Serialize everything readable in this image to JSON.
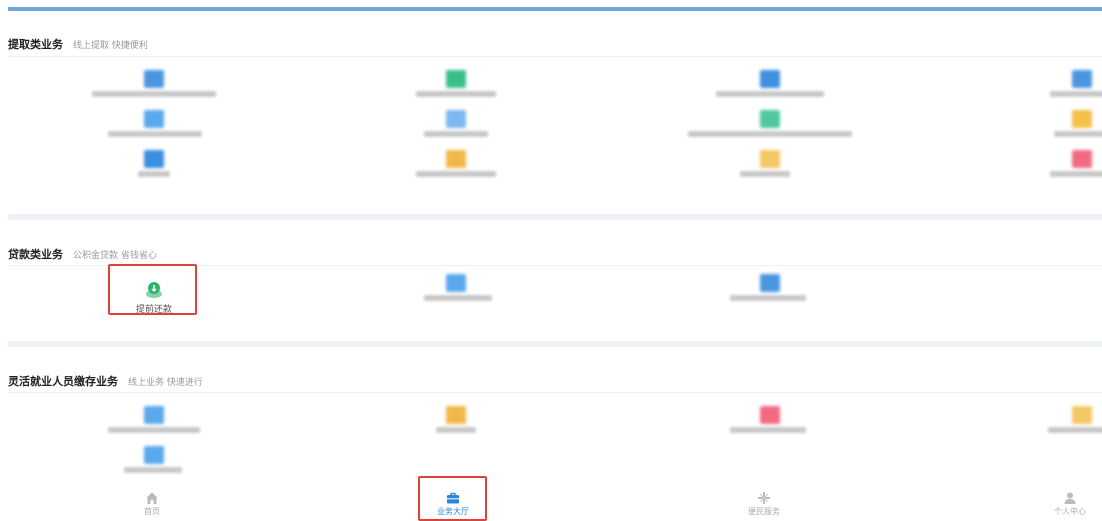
{
  "sections": [
    {
      "title": "提取类业务",
      "subtitle": "线上提取 快捷便利"
    },
    {
      "title": "贷款类业务",
      "subtitle": "公积金贷款 省钱省心"
    },
    {
      "title": "灵活就业人员缴存业务",
      "subtitle": "线上业务 快速进行"
    }
  ],
  "loan_items": {
    "prepay": {
      "label": "提前还款",
      "icon": "leaf-coin-icon"
    }
  },
  "tabbar": [
    {
      "label": "首页",
      "icon": "home-icon",
      "active": false
    },
    {
      "label": "业务大厅",
      "icon": "briefcase-icon",
      "active": true
    },
    {
      "label": "便民服务",
      "icon": "service-icon",
      "active": false
    },
    {
      "label": "个人中心",
      "icon": "user-icon",
      "active": false
    }
  ],
  "colors": {
    "accent": "#2b84d9",
    "highlight": "#e0423a",
    "top_bar": "#6fa8dc",
    "green": "#2fb56a"
  }
}
